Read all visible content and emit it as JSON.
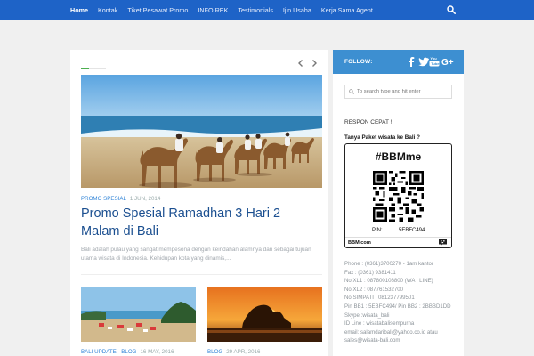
{
  "nav": {
    "items": [
      {
        "label": "Home",
        "active": true
      },
      {
        "label": "Kontak"
      },
      {
        "label": "Tiket Pesawat Promo"
      },
      {
        "label": "INFO REK"
      },
      {
        "label": "Testimonials"
      },
      {
        "label": "Ijin Usaha"
      },
      {
        "label": "Kerja Sama Agent"
      }
    ],
    "search_icon": "search-icon",
    "bg_color": "#1e63c7"
  },
  "main": {
    "slider_controls": {
      "prev_icon": "chevron-left-icon",
      "next_icon": "chevron-right-icon"
    },
    "featured": {
      "category": "PROMO SPESIAL",
      "date": "1 JUN, 2014",
      "title": "Promo Spesial Ramadhan 3 Hari 2 Malam di Bali",
      "excerpt": "Bali adalah pulau yang sangat mempesona dengan keindahan alamnya dan sebagai tujuan utama wisata di Indonesia. Kehidupan kota yang dinamis,..."
    },
    "posts": [
      {
        "category": "BALI UPDATE",
        "category2": "BLOG",
        "date": "16 MAY, 2016"
      },
      {
        "category": "BLOG",
        "date": "29 APR, 2016"
      }
    ],
    "accent_color": "#2f83d7"
  },
  "sidebar": {
    "follow_label": "FOLLOW:",
    "social_icons": [
      "facebook-icon",
      "twitter-icon",
      "youtube-icon",
      "google-plus-icon"
    ],
    "search_placeholder": "To search type and hit enter",
    "respon_title": "RESPON CEPAT !",
    "tanya_label": "Tanya Paket wisata ke Bali ?",
    "bbm": {
      "title": "#BBMme",
      "pin_label": "PIN:",
      "pin_value": "5EBFC494",
      "url": "BBM.com"
    },
    "contact_lines": [
      "Phone : (0361)3700270 - 1am kantor",
      "Fax : (0361) 9381411",
      "No.XL1 : 087800108800 (WA , LINE)",
      "No.XL2 : 087761532700",
      "No.SIMPATI : 081237799501",
      "Pin BB1 : 5EBFC494/ Pin BB2 : 2BBBD1DD",
      "Skype :wisata_bali",
      "ID Line : wisatabalisempurna",
      "email: salamdaribali@yahoo.co.id atau",
      "sales@wisata-bali.com"
    ],
    "header_color": "#3d8fd1"
  }
}
